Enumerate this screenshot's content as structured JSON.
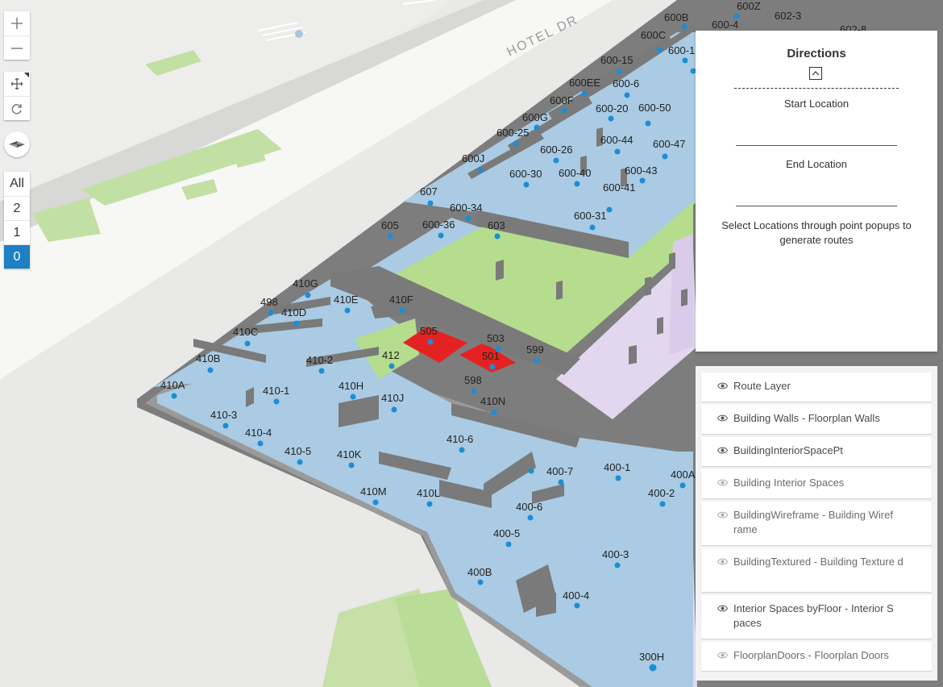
{
  "map": {
    "road_label": "HOTEL DR",
    "room_labels": [
      "600B",
      "600Z",
      "602-3",
      "600-4",
      "602-8",
      "600C",
      "600-1",
      "600-15",
      "600EE",
      "600-6",
      "600F",
      "600-20",
      "600-50",
      "600G",
      "600-25",
      "600-44",
      "600-47",
      "600-26",
      "600J",
      "600-30",
      "600-40",
      "600-43",
      "600-41",
      "607",
      "600-34",
      "600-31",
      "605",
      "600-36",
      "603",
      "410G",
      "498",
      "410E",
      "410F",
      "410D",
      "410C",
      "505",
      "503",
      "410B",
      "412",
      "501",
      "599",
      "410-2",
      "410A",
      "598",
      "410H",
      "410-1",
      "410N",
      "410J",
      "410-3",
      "410-4",
      "410-6",
      "410-5",
      "410K",
      "400-1",
      "400A",
      "400-7",
      "400-2",
      "410M",
      "410L",
      "400-6",
      "400-5",
      "400-3",
      "400B",
      "400-4",
      "300H"
    ]
  },
  "nav": {
    "zoom_in_icon": "plus-icon",
    "zoom_out_icon": "minus-icon",
    "pan_icon": "pan-arrows-icon",
    "rotate_icon": "rotate-icon",
    "compass_icon": "compass-icon"
  },
  "floors": {
    "items": [
      "All",
      "2",
      "1",
      "0"
    ],
    "selected": "0",
    "active_color": "#1d7fc4"
  },
  "directions": {
    "title": "Directions",
    "collapse_icon": "chevron-up-icon",
    "start_label": "Start Location",
    "end_label": "End Location",
    "hint": "Select Locations through point popups to generate routes"
  },
  "layers": {
    "eye_icon": "eye-icon",
    "items": [
      "Route Layer",
      "Building Walls - Floorplan Walls",
      "BuildingInteriorSpacePt",
      "Building Interior Spaces",
      "BuildingWireframe - Building Wiref rame",
      "BuildingTextured - Building Texture d",
      "Interior Spaces byFloor - Interior S paces",
      "FloorplanDoors - Floorplan Doors"
    ]
  },
  "colors": {
    "room_fill": "#aacbe3",
    "wall": "#8a8a8a",
    "courtyard": "#b5dd8d",
    "selected_room": "#e52222",
    "marker": "#1a8ed6",
    "lilac": "#e3d7ef"
  }
}
